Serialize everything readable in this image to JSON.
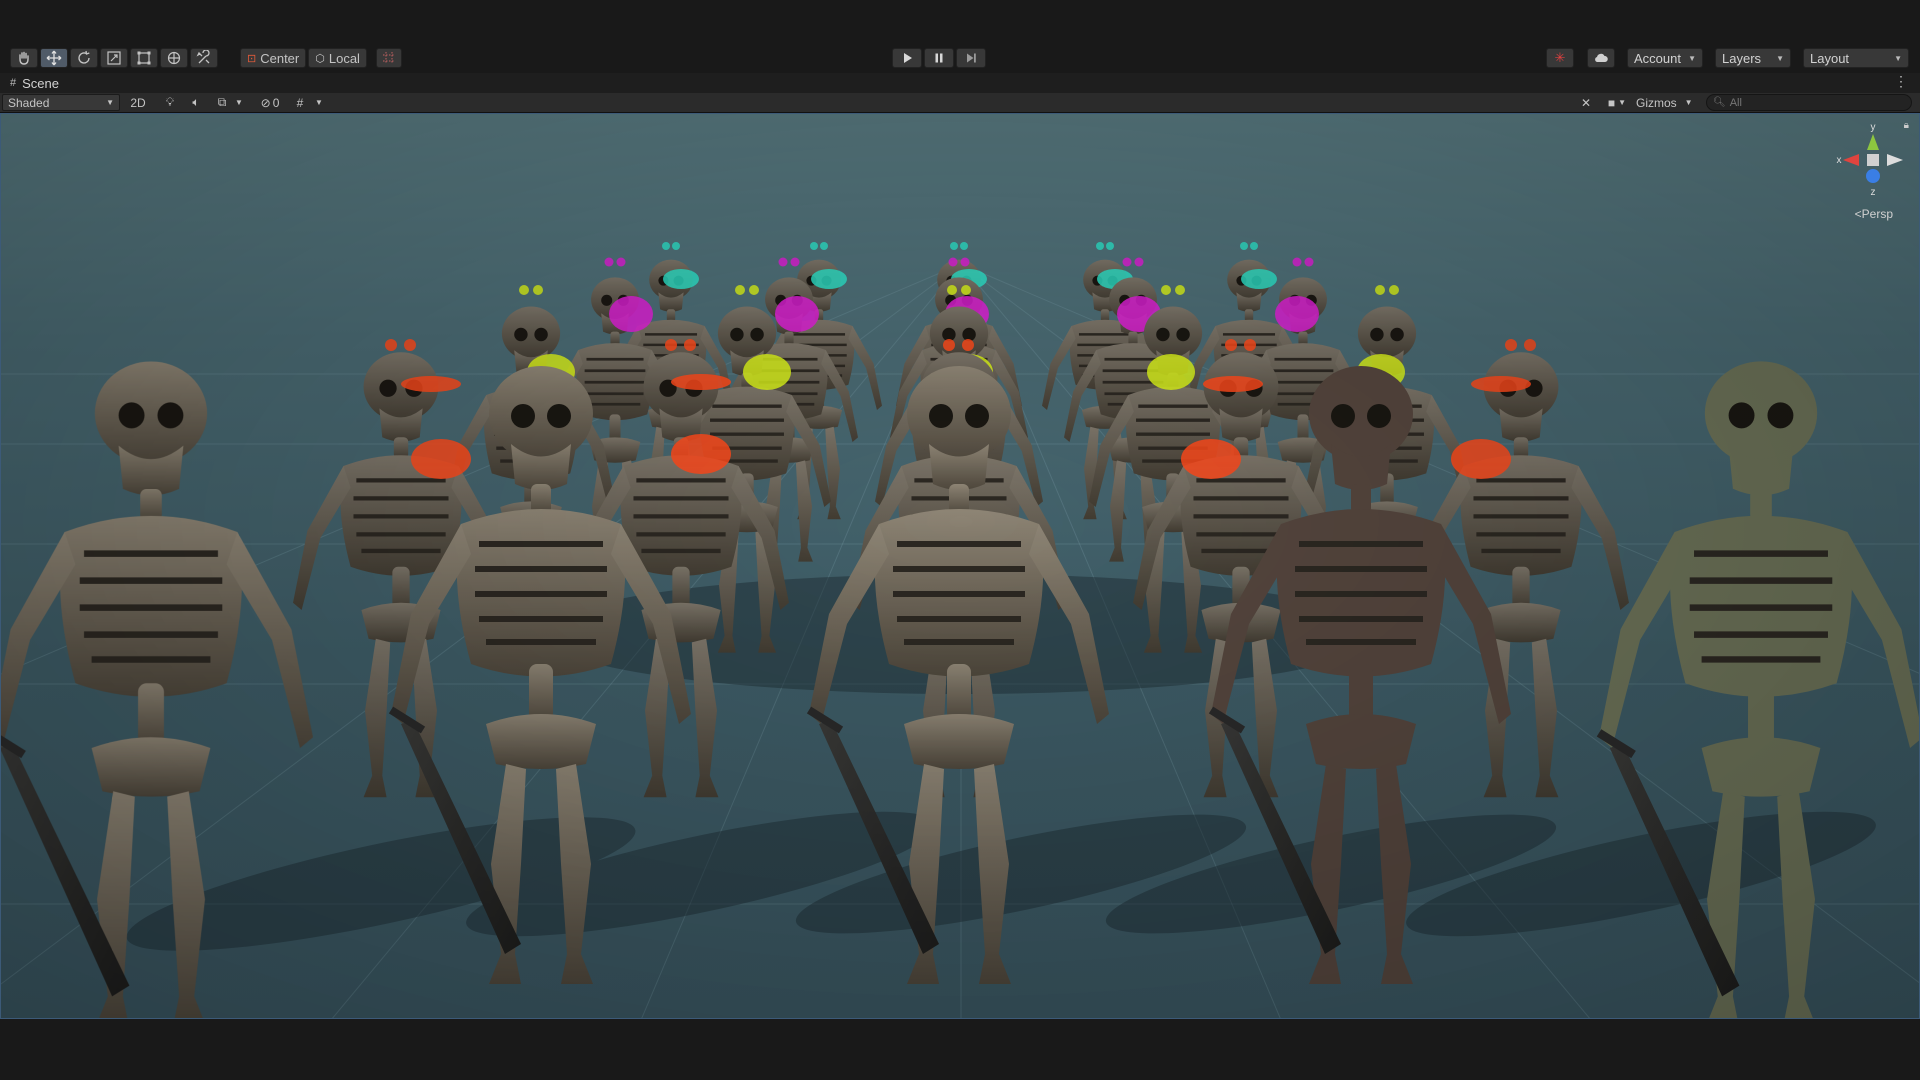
{
  "toolbar": {
    "tools": [
      {
        "name": "hand-tool",
        "icon": "hand-icon"
      },
      {
        "name": "move-tool",
        "icon": "move-icon",
        "active": true
      },
      {
        "name": "rotate-tool",
        "icon": "rotate-icon"
      },
      {
        "name": "scale-tool",
        "icon": "scale-icon"
      },
      {
        "name": "rect-tool",
        "icon": "rect-icon"
      },
      {
        "name": "transform-tool",
        "icon": "transform-icon"
      },
      {
        "name": "custom-tool",
        "icon": "wrench-icon"
      }
    ],
    "pivot_label": "Center",
    "space_label": "Local",
    "play_icon": "play-icon",
    "pause_icon": "pause-icon",
    "step_icon": "step-icon",
    "account_label": "Account",
    "layers_label": "Layers",
    "layout_label": "Layout"
  },
  "tab": {
    "label": "Scene",
    "icon": "grid-icon"
  },
  "scene_toolbar": {
    "draw_mode": "Shaded",
    "mode_2d": "2D",
    "hidden_count": "0",
    "gizmos_label": "Gizmos",
    "search_placeholder": "All"
  },
  "gizmo": {
    "y_label": "y",
    "x_label": "x",
    "z_label": "z",
    "projection_label": "Persp"
  },
  "colors": {
    "accent_active": "#505b68",
    "axis_x": "#e0443e",
    "axis_y": "#8dc63f",
    "axis_z": "#3a7ee5",
    "glow_red": "#ff4a1c",
    "glow_yellow": "#d8f01a",
    "glow_magenta": "#e020d8",
    "glow_cyan": "#2ee0c8"
  }
}
